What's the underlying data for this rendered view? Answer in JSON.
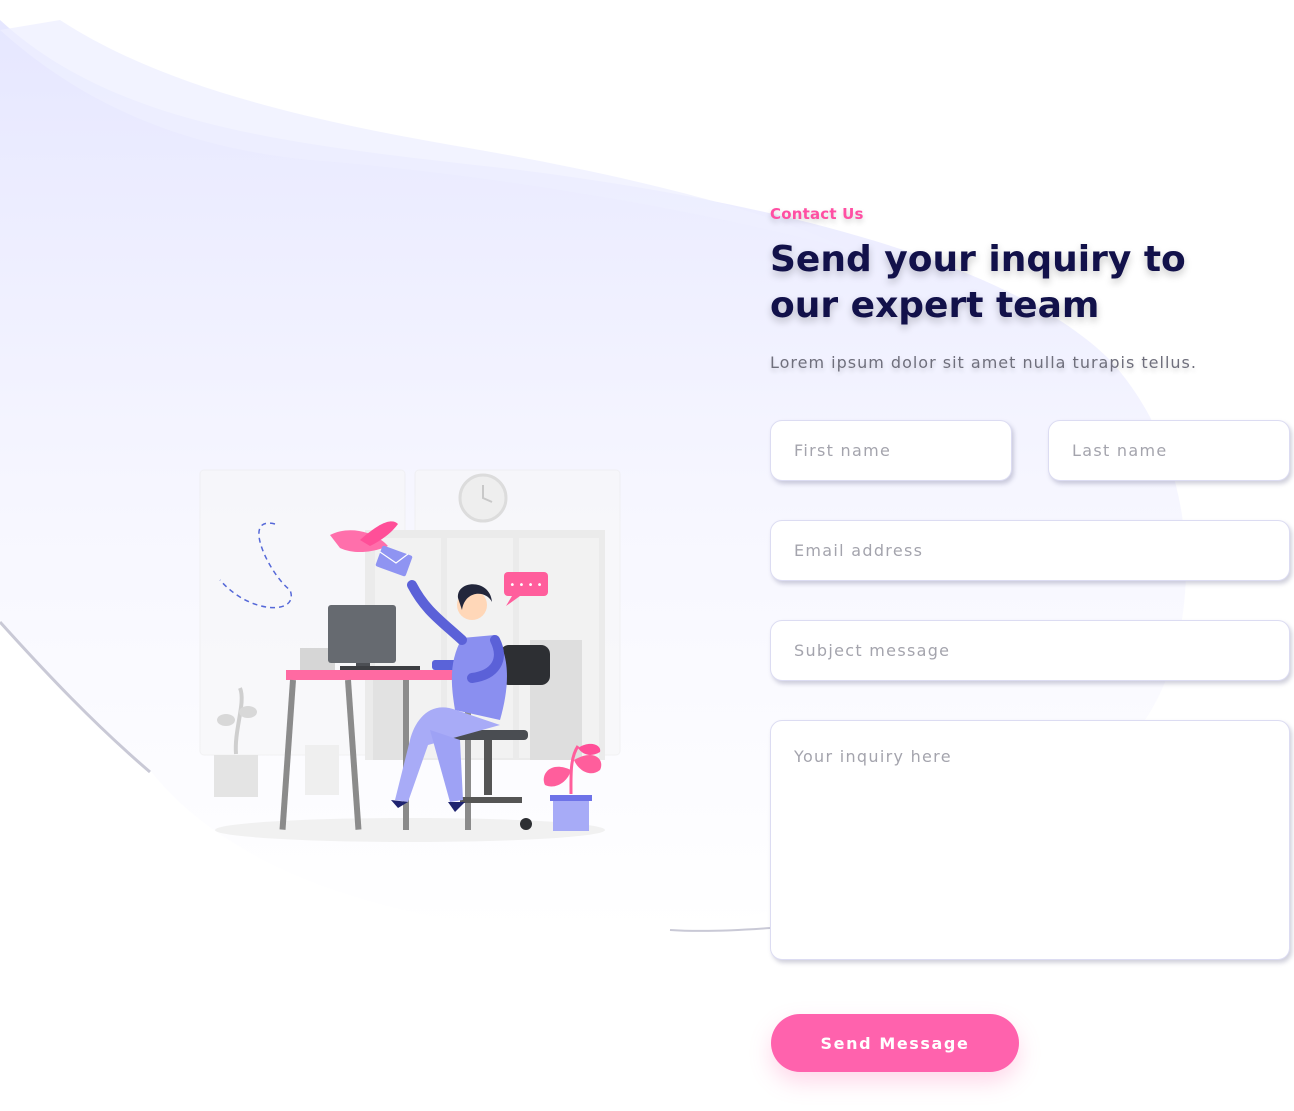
{
  "contact": {
    "eyebrow": "Contact Us",
    "heading": "Send your inquiry to our expert team",
    "subtext": "Lorem ipsum dolor sit amet nulla turapis tellus."
  },
  "form": {
    "first_name_placeholder": "First name",
    "last_name_placeholder": "Last name",
    "email_placeholder": "Email address",
    "subject_placeholder": "Subject message",
    "inquiry_placeholder": "Your inquiry here",
    "submit_label": "Send Message"
  },
  "illustration": {
    "chat_bubble_text": "• • • •"
  },
  "colors": {
    "accent_pink": "#ff62ad",
    "heading_navy": "#12114a",
    "illustration_purple": "#7f83ee"
  }
}
